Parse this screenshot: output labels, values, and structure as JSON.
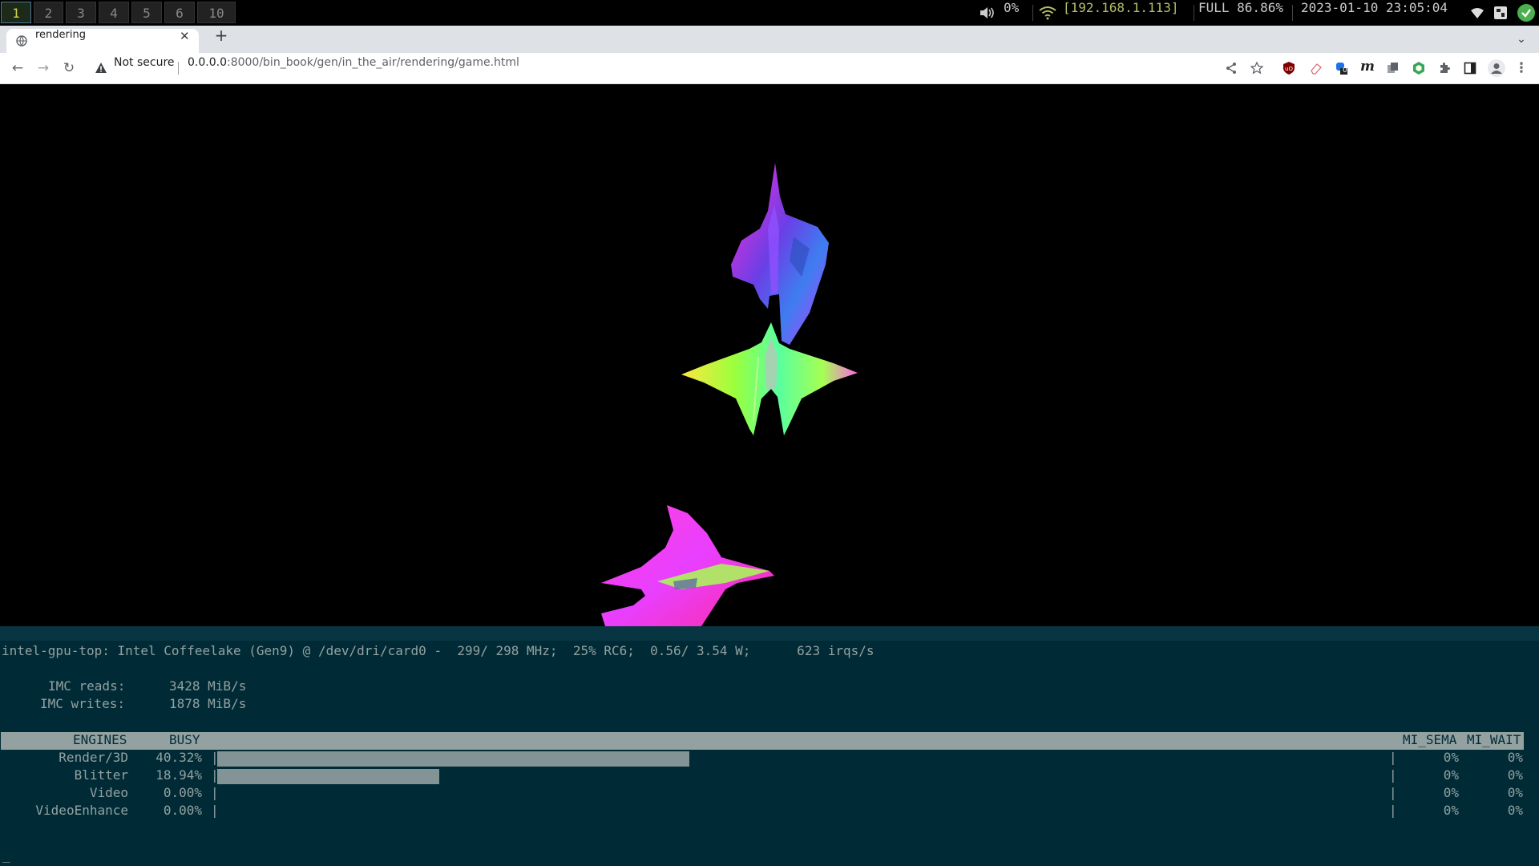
{
  "bar": {
    "workspaces": [
      "1",
      "2",
      "3",
      "4",
      "5",
      "6",
      "10"
    ],
    "volume": "0%",
    "ip": "[192.168.1.113]",
    "battery": "FULL 86.86%",
    "datetime": "2023-01-10 23:05:04",
    "colors": {
      "focused_border": "#4c7899",
      "green": "#b5bd68"
    }
  },
  "browser": {
    "tab_title": "rendering",
    "new_tab": "+",
    "security": "Not secure",
    "url_host": "0.0.0.0",
    "url_rest": ":8000/bin_book/gen/in_the_air/rendering/game.html",
    "extension_badge": "0"
  },
  "terminal": {
    "line1": "intel-gpu-top: Intel Coffeelake (Gen9) @ /dev/dri/card0 -  299/ 298 MHz;  25% RC6;  0.56/ 3.54 W;      623 irqs/s",
    "imc_reads_label": "IMC reads:",
    "imc_reads_value": "3428 MiB/s",
    "imc_writes_label": "IMC writes:",
    "imc_writes_value": "1878 MiB/s",
    "headers": {
      "engines": "ENGINES",
      "busy": "BUSY",
      "mi_sema": "MI_SEMA",
      "mi_wait": "MI_WAIT"
    },
    "engines": [
      {
        "name": "Render/3D",
        "busy": "40.32%",
        "level": 0.4032,
        "sema": "0%",
        "wait": "0%"
      },
      {
        "name": "Blitter",
        "busy": "18.94%",
        "level": 0.1894,
        "sema": "0%",
        "wait": "0%"
      },
      {
        "name": "Video",
        "busy": "0.00%",
        "level": 0,
        "sema": "0%",
        "wait": "0%"
      },
      {
        "name": "VideoEnhance",
        "busy": "0.00%",
        "level": 0,
        "sema": "0%",
        "wait": "0%"
      }
    ],
    "cursor": "_",
    "colors": {
      "bg": "#002b36",
      "fg": "#93a1a1",
      "bar": "#839496"
    }
  }
}
